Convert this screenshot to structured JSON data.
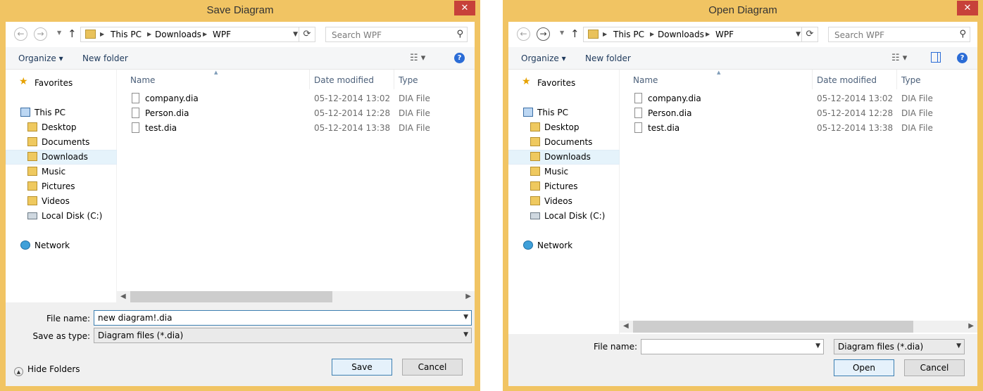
{
  "save_dialog": {
    "title": "Save Diagram",
    "close_label": "✕",
    "back_glyph": "←",
    "forward_glyph": "→",
    "up_glyph": "↑",
    "breadcrumb": [
      "This PC",
      "Downloads",
      "WPF"
    ],
    "search_placeholder": "Search WPF",
    "toolbar": {
      "organize": "Organize ▾",
      "new_folder": "New folder",
      "view_icon": "details-view-icon",
      "help": "?"
    },
    "sidebar": {
      "favorites": "Favorites",
      "this_pc": "This PC",
      "desktop": "Desktop",
      "documents": "Documents",
      "downloads": "Downloads",
      "music": "Music",
      "pictures": "Pictures",
      "videos": "Videos",
      "local_disk": "Local Disk (C:)",
      "network": "Network"
    },
    "columns": {
      "name": "Name",
      "date": "Date modified",
      "type": "Type"
    },
    "files": [
      {
        "name": "company.dia",
        "date": "05-12-2014 13:02",
        "type": "DIA File"
      },
      {
        "name": "Person.dia",
        "date": "05-12-2014 12:28",
        "type": "DIA File"
      },
      {
        "name": "test.dia",
        "date": "05-12-2014 13:38",
        "type": "DIA File"
      }
    ],
    "file_name_label": "File name:",
    "file_name_value": "new diagram!.dia",
    "save_as_type_label": "Save as type:",
    "save_as_type_value": "Diagram files (*.dia)",
    "hide_folders": "Hide Folders",
    "save_button": "Save",
    "cancel_button": "Cancel"
  },
  "open_dialog": {
    "title": "Open Diagram",
    "close_label": "✕",
    "back_glyph": "←",
    "forward_glyph": "→",
    "up_glyph": "↑",
    "breadcrumb": [
      "This PC",
      "Downloads",
      "WPF"
    ],
    "search_placeholder": "Search WPF",
    "toolbar": {
      "organize": "Organize ▾",
      "new_folder": "New folder",
      "view_icon": "details-view-icon",
      "preview_icon": "preview-pane-icon",
      "help": "?"
    },
    "sidebar": {
      "favorites": "Favorites",
      "this_pc": "This PC",
      "desktop": "Desktop",
      "documents": "Documents",
      "downloads": "Downloads",
      "music": "Music",
      "pictures": "Pictures",
      "videos": "Videos",
      "local_disk": "Local Disk (C:)",
      "network": "Network"
    },
    "columns": {
      "name": "Name",
      "date": "Date modified",
      "type": "Type"
    },
    "files": [
      {
        "name": "company.dia",
        "date": "05-12-2014 13:02",
        "type": "DIA File"
      },
      {
        "name": "Person.dia",
        "date": "05-12-2014 12:28",
        "type": "DIA File"
      },
      {
        "name": "test.dia",
        "date": "05-12-2014 13:38",
        "type": "DIA File"
      }
    ],
    "file_name_label": "File name:",
    "file_name_value": "",
    "filter_value": "Diagram files (*.dia)",
    "open_button": "Open",
    "cancel_button": "Cancel"
  },
  "colors": {
    "frame": "#f1c463",
    "close": "#c7413a",
    "selection": "#e5f3fb",
    "accent": "#3c7fb1"
  }
}
